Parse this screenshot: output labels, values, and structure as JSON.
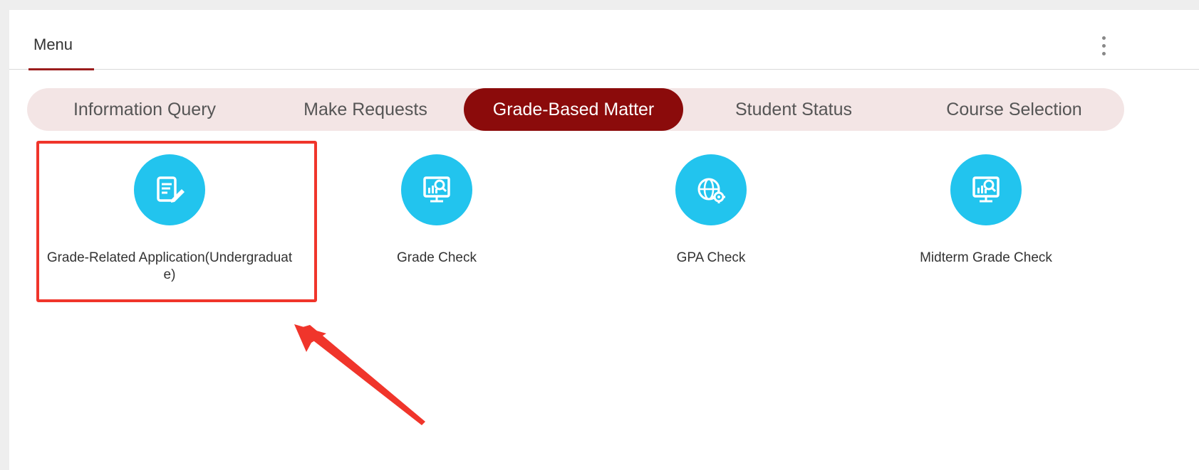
{
  "panel": {
    "title": "Menu"
  },
  "tabs": [
    {
      "label": "Information Query",
      "active": false
    },
    {
      "label": "Make Requests",
      "active": false
    },
    {
      "label": "Grade-Based Matter",
      "active": true
    },
    {
      "label": "Student Status",
      "active": false
    },
    {
      "label": "Course Selection",
      "active": false
    }
  ],
  "tiles": [
    {
      "label_line1": "Grade-Related Application(Undergraduat",
      "label_line2": "e)",
      "icon": "edit-document-icon"
    },
    {
      "label_line1": "Grade Check",
      "label_line2": "",
      "icon": "monitor-search-icon"
    },
    {
      "label_line1": "GPA Check",
      "label_line2": "",
      "icon": "gpa-globe-gear-icon"
    },
    {
      "label_line1": "Midterm Grade Check",
      "label_line2": "",
      "icon": "monitor-search-icon"
    }
  ],
  "colors": {
    "accent": "#8b0b0b",
    "tab_bar_bg": "#f3e5e5",
    "icon_bg": "#22c4ee",
    "annotation": "#f0352b"
  }
}
